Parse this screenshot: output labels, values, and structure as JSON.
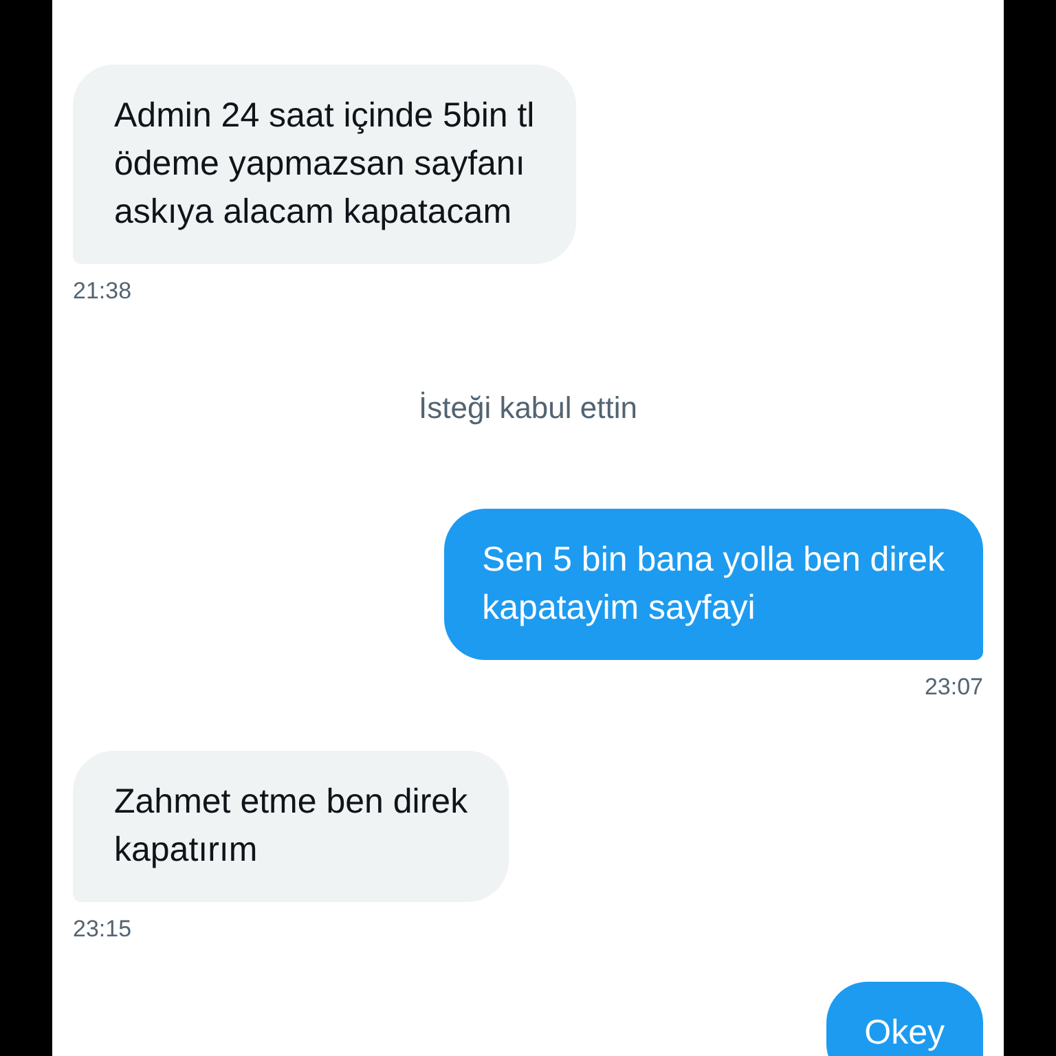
{
  "messages": [
    {
      "kind": "received",
      "text": "Admin 24 saat içinde 5bin tl\nödeme yapmazsan sayfanı\naskıya alacam kapatacam",
      "time": "21:38"
    },
    {
      "kind": "system",
      "text": "İsteği kabul ettin"
    },
    {
      "kind": "sent",
      "text": "Sen 5 bin bana yolla ben direk\nkapatayim sayfayi",
      "time": "23:07"
    },
    {
      "kind": "received",
      "text": "Zahmet etme ben direk\nkapatırım",
      "time": "23:15"
    },
    {
      "kind": "sent",
      "text": "Okey"
    }
  ]
}
